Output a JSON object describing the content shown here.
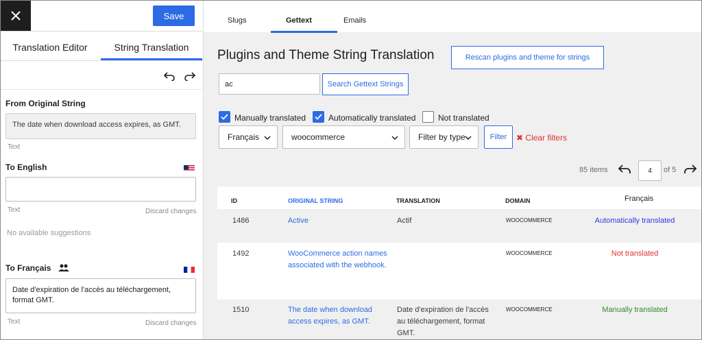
{
  "left_panel": {
    "save_label": "Save",
    "tabs": [
      {
        "label": "Translation Editor"
      },
      {
        "label": "String Translation",
        "active": true
      }
    ],
    "from_original_label": "From Original String",
    "original_text": "The date when download access expires, as GMT.",
    "text_label": "Text",
    "to_english_label": "To English",
    "english_value": "",
    "discard_label": "Discard changes",
    "no_suggestions": "No available suggestions",
    "to_french_label": "To Français",
    "french_value": "Date d'expiration de l'accès au téléchargement, format GMT."
  },
  "right_panel": {
    "tabs": [
      {
        "label": "Slugs"
      },
      {
        "label": "Gettext",
        "active": true
      },
      {
        "label": "Emails"
      }
    ],
    "title": "Plugins and Theme String Translation",
    "rescan_label": "Rescan plugins and theme for strings",
    "search_value": "ac",
    "search_button": "Search Gettext Strings",
    "checkboxes": [
      {
        "label": "Manually translated",
        "checked": true
      },
      {
        "label": "Automatically translated",
        "checked": true
      },
      {
        "label": "Not translated",
        "checked": false
      }
    ],
    "filters": {
      "language": "Français",
      "domain": "woocommerce",
      "type": "Filter by type",
      "filter_button": "Filter",
      "clear_label": "Clear filters"
    },
    "pagination": {
      "items": "85 items",
      "current_page": "4",
      "of_pages": "of 5"
    },
    "table": {
      "headers": [
        "ID",
        "ORIGINAL STRING",
        "TRANSLATION",
        "DOMAIN",
        "Français"
      ],
      "rows": [
        {
          "id": "1486",
          "original": "Active",
          "translation": "Actif",
          "domain": "WOOCOMMERCE",
          "status": "Automatically translated"
        },
        {
          "id": "1492",
          "original": "WooCommerce action names associated with the webhook.",
          "translation": "",
          "domain": "WOOCOMMERCE",
          "status": "Not translated"
        },
        {
          "id": "1510",
          "original": "The date when download access expires, as GMT.",
          "translation": "Date d'expiration de l'accès au téléchargement, format GMT.",
          "domain": "WOOCOMMERCE",
          "status": "Manually translated"
        }
      ]
    }
  },
  "colors": {
    "accent": "#2d6be4",
    "auto_status": "#2d3ce4",
    "not_translated": "#e0302c",
    "manual_status": "#2e8b2e"
  }
}
